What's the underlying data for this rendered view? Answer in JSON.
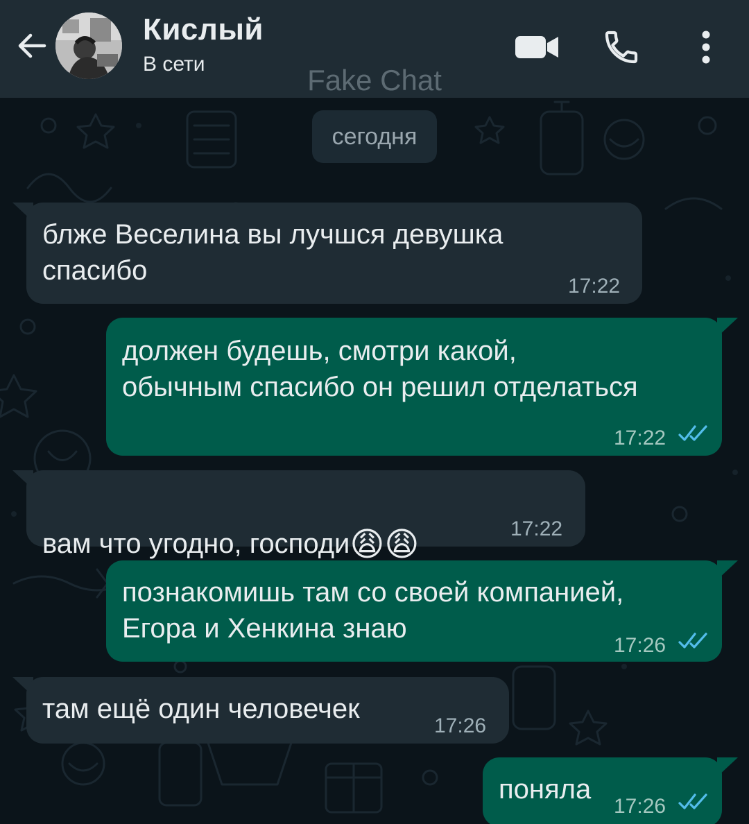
{
  "header": {
    "contact_name": "Кислый",
    "status": "В сети",
    "watermark": "Fake Chat",
    "icons": {
      "back": "arrow-left-icon",
      "video": "video-camera-icon",
      "call": "phone-icon",
      "menu": "more-vertical-icon"
    }
  },
  "chat": {
    "date_label": "сегодня",
    "messages": [
      {
        "direction": "in",
        "text": "блже Веселина вы лучшся девушка\nспасибо",
        "time": "17:22"
      },
      {
        "direction": "out",
        "text": "должен будешь, смотри какой,\nобычным спасибо он решил отделаться",
        "time": "17:22",
        "status": "read"
      },
      {
        "direction": "in",
        "text": "вам что угодно, господи",
        "emoji": "😩😩",
        "time": "17:22"
      },
      {
        "direction": "out",
        "text": "познакомишь там со своей компанией,\nЕгора и Хенкина знаю",
        "time": "17:26",
        "status": "read"
      },
      {
        "direction": "in",
        "text": "там ещё один человечек",
        "time": "17:26"
      },
      {
        "direction": "out",
        "text": "поняла",
        "time": "17:26",
        "status": "read"
      }
    ]
  },
  "colors": {
    "header_bg": "#1f2c34",
    "chat_bg": "#0b141a",
    "incoming_bubble": "#1f2c34",
    "outgoing_bubble": "#005c4b",
    "read_tick": "#53bdeb"
  }
}
